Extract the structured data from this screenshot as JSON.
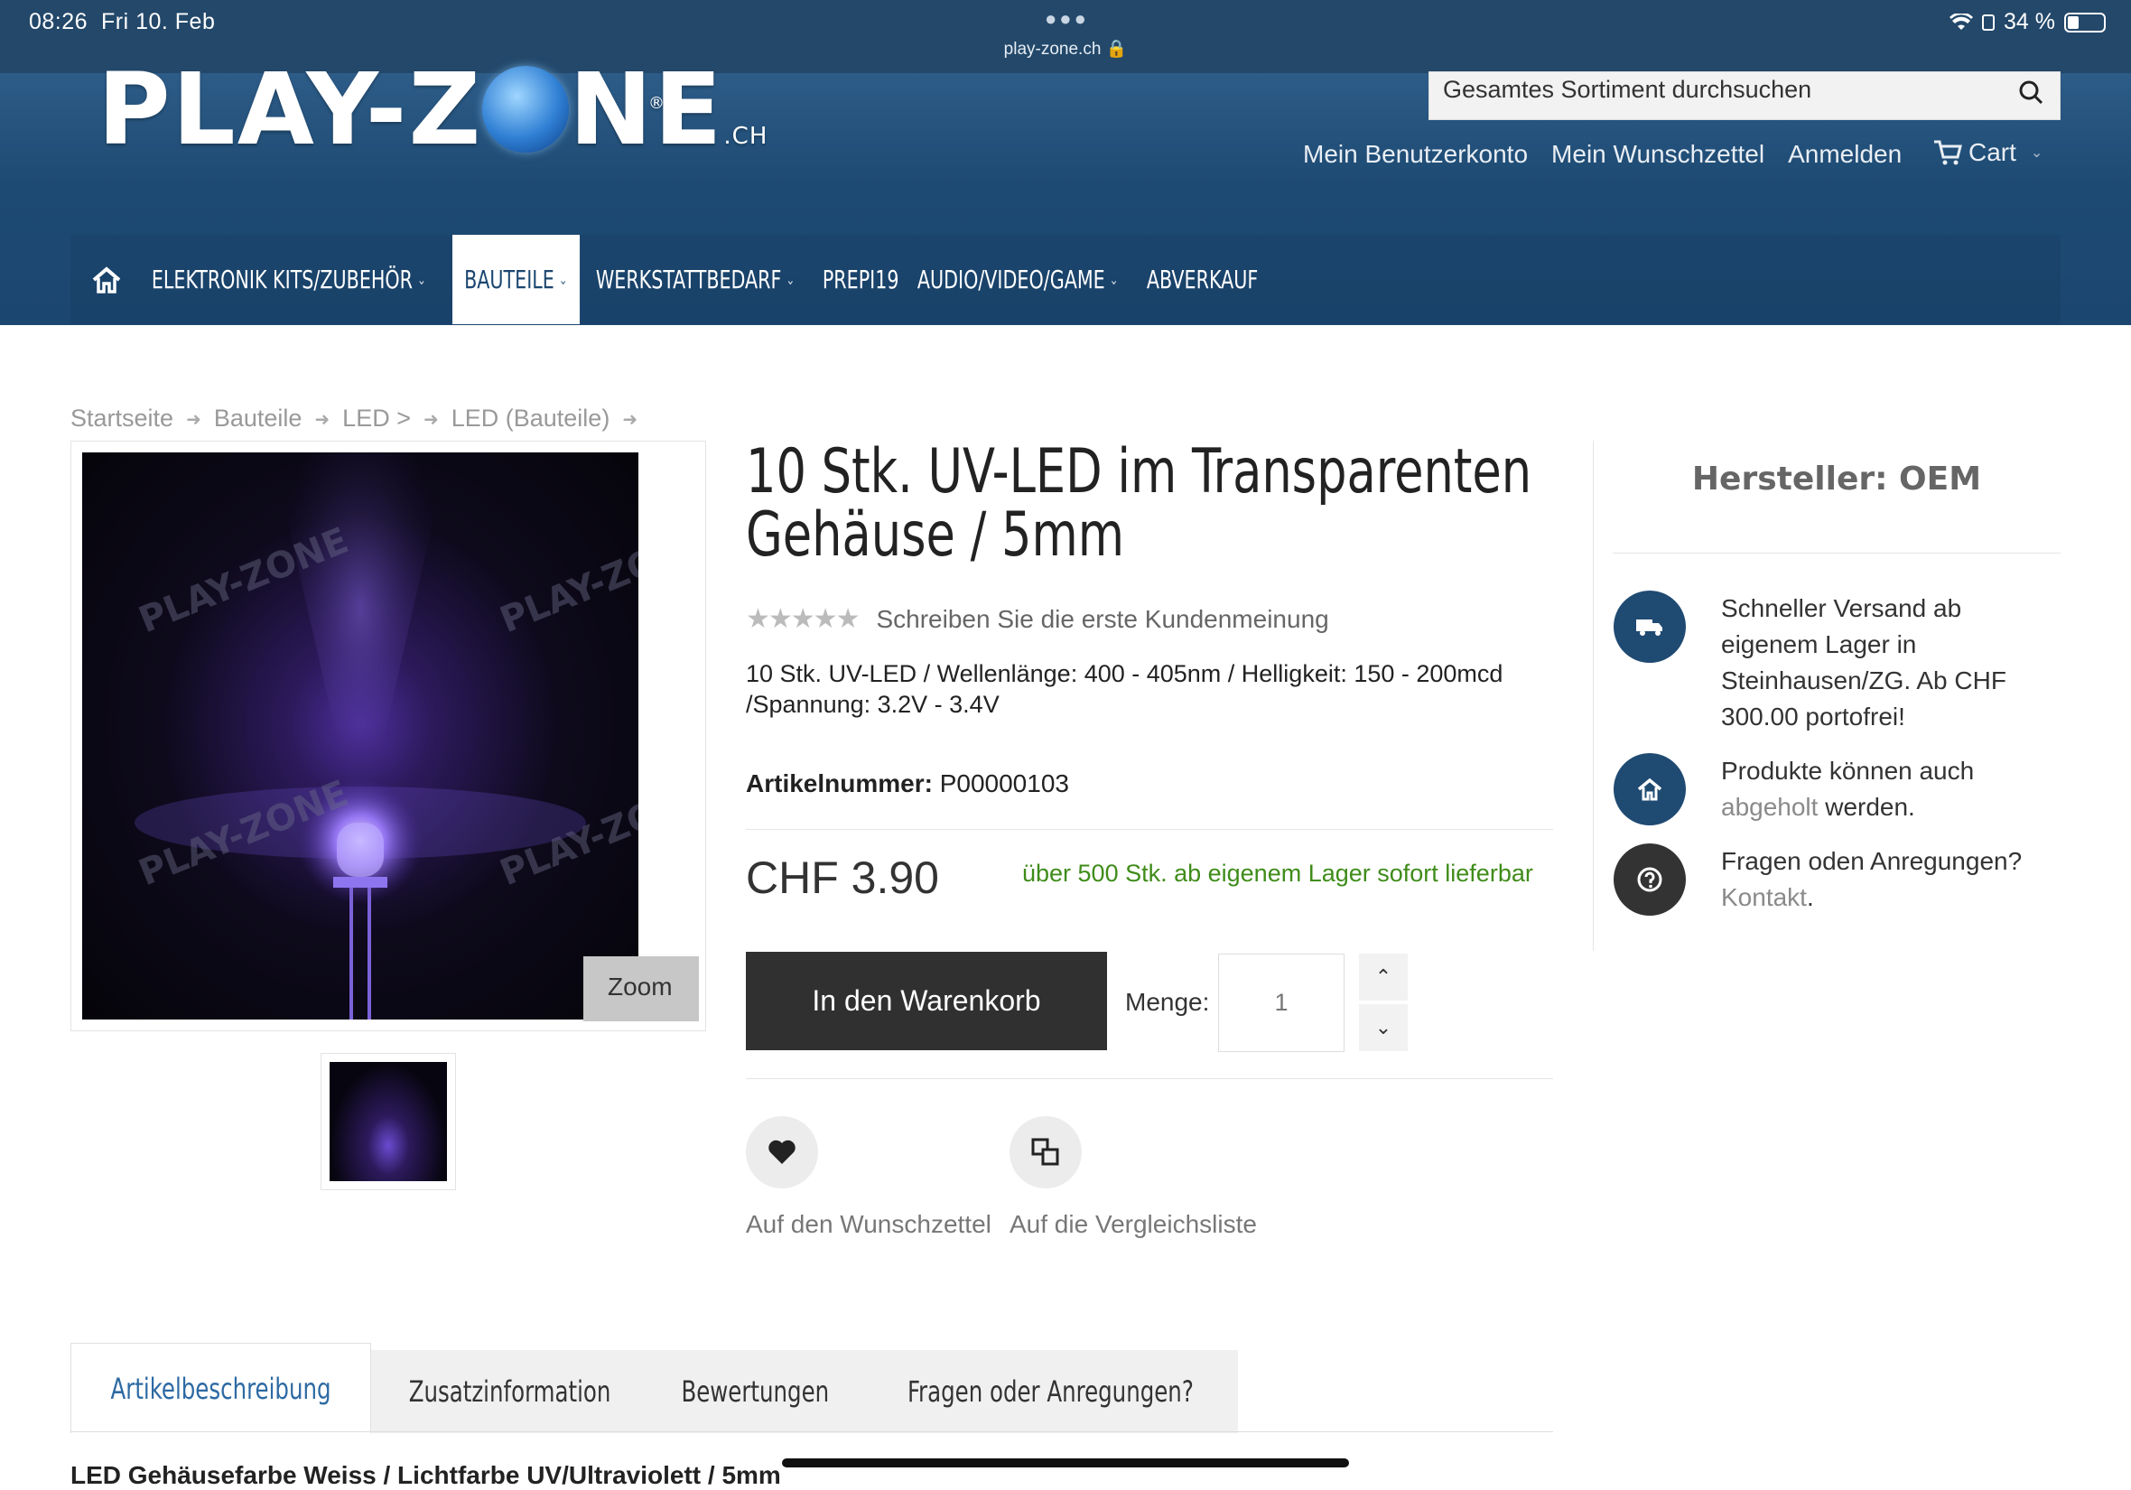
{
  "status_bar": {
    "time": "08:26",
    "date": "Fri 10. Feb",
    "url": "play-zone.ch",
    "battery": "34 %"
  },
  "header": {
    "logo_text_left": "PLAY-Z",
    "logo_text_right": "NE",
    "logo_suffix": ".CH",
    "logo_reg": "®",
    "search_placeholder": "Gesamtes Sortiment durchsuchen",
    "links": [
      "Mein Benutzerkonto",
      "Mein Wunschzettel",
      "Anmelden"
    ],
    "cart_label": "Cart"
  },
  "nav": {
    "items": [
      {
        "label": "ELEKTRONIK KITS/ZUBEHÖR",
        "has_dropdown": true
      },
      {
        "label": "BAUTEILE",
        "has_dropdown": true,
        "active": true
      },
      {
        "label": "WERKSTATTBEDARF",
        "has_dropdown": true
      },
      {
        "label": "PREPI19",
        "has_dropdown": false
      },
      {
        "label": "AUDIO/VIDEO/GAME",
        "has_dropdown": true
      },
      {
        "label": "ABVERKAUF",
        "has_dropdown": false
      }
    ]
  },
  "breadcrumb": [
    "Startseite",
    "Bauteile",
    "LED >",
    "LED (Bauteile)"
  ],
  "product": {
    "title_line1": "10 Stk. UV-LED im Transparenten",
    "title_line2": "Gehäuse / 5mm",
    "rating_stars": 0,
    "review_link": "Schreiben Sie die erste Kundenmeinung",
    "description": "10 Stk. UV-LED / Wellenlänge: 400 - 405nm / Helligkeit: 150 - 200mcd /Spannung: 3.2V - 3.4V",
    "sku_label": "Artikelnummer:",
    "sku_value": "P00000103",
    "price": "CHF 3.90",
    "stock": "über 500 Stk. ab eigenem Lager sofort lieferbar",
    "zoom_label": "Zoom",
    "add_to_cart": "In den Warenkorb",
    "qty_label": "Menge:",
    "qty_value": "1",
    "wishlist_label": "Auf den Wunschzettel",
    "compare_label": "Auf die Vergleichsliste",
    "watermark": "PLAY-ZONE"
  },
  "sidebar": {
    "manufacturer": "Hersteller: OEM",
    "shipping_text": "Schneller Versand ab eigenem Lager in Steinhausen/ZG. Ab CHF 300.00 portofrei!",
    "pickup_pre": "Produkte können auch",
    "pickup_link": "abgeholt",
    "pickup_post": "werden.",
    "questions_text": "Fragen oden Anregungen?",
    "contact_link": "Kontakt",
    "contact_post": ".",
    "icon_colors": {
      "shipping": "#1f4a72",
      "pickup": "#1f4a72",
      "questions": "#333333"
    }
  },
  "tabs": [
    {
      "label": "Artikelbeschreibung",
      "active": true
    },
    {
      "label": "Zusatzinformation"
    },
    {
      "label": "Bewertungen"
    },
    {
      "label": "Fragen oder Anregungen?"
    }
  ],
  "tab_content_heading": "LED Gehäusefarbe Weiss / Lichtfarbe UV/Ultraviolett / 5mm",
  "colors": {
    "brand_blue": "#1b4670",
    "stock_green": "#3f8c1a",
    "tab_active": "#2d6aa3"
  }
}
